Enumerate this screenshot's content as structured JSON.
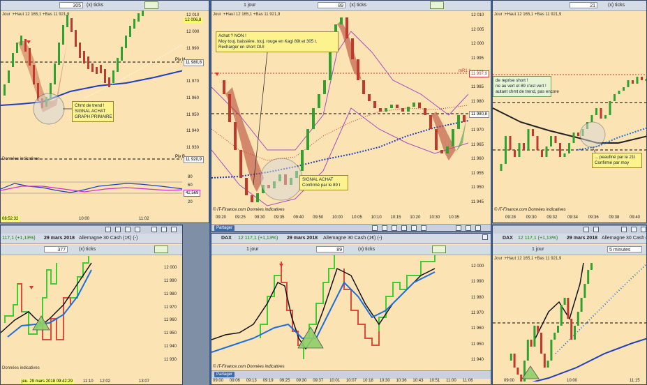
{
  "toolbar": {
    "ticks_label": "(x) ticks",
    "period_label": "1 jour",
    "period_5min": "5 minutes",
    "p1_ticks": "305",
    "p2_ticks": "89",
    "p3_ticks": "21",
    "p4_ticks": "377",
    "p5_ticks": "89",
    "symbol": "DAX",
    "quote": "12 117,1 (+1,13%)",
    "quote_short": "117,1 (+1,13%)",
    "date": "29 mars 2018",
    "instrument": "Allemagne 30 Cash (1€) (-)"
  },
  "common": {
    "day_info": "Jour :+Haut 12 165,1 +Bas 11 921,9",
    "donnees": "Données indicatives",
    "itf": "© IT-Finance.com  Données indicatives",
    "partager": "Partager",
    "piv_h": "Piv H",
    "piv_b": "Piv B"
  },
  "panel1": {
    "price_tag": "12 006,8",
    "pivh_tag": "11 980,8",
    "pivb_tag": "11 920,9",
    "ind_tag": "42,569",
    "time_tag": "08:52:32",
    "yticks": [
      "12 010",
      "12 000",
      "11 990",
      "11 980",
      "11 970",
      "11 960",
      "11 950",
      "11 940",
      "11 930"
    ],
    "ind_ticks": [
      "80",
      "60",
      "40",
      "20"
    ],
    "xticks": [
      "10:00",
      "11:02"
    ],
    "note": "Chmt de trend !\nSIGNAL ACHAT\nGRAPH PRIMAIRE"
  },
  "panel2": {
    "yticks": [
      "12 010",
      "12 005",
      "12 000",
      "11 995",
      "11 990",
      "11 985",
      "11 980",
      "11 975",
      "11 970",
      "11 965",
      "11 960",
      "11 955",
      "11 950",
      "11 945"
    ],
    "xticks": [
      "09:20",
      "09:25",
      "09:30",
      "09:35",
      "09:40",
      "09:50",
      "10:00",
      "10:05",
      "10:10",
      "10:15",
      "10:20",
      "10:30",
      "10:35"
    ],
    "r1_label": "mR1 1",
    "r1_tag": "11 997,9",
    "mid_tag": "11 980,8",
    "note": "Achat ? NON !\nMoy touj. baissière, touj. rouge en Kagi 89t et 305 t.\nRecharger en short OUI",
    "signal": "SIGNAL ACHAT\nConfirmé par le 89 t"
  },
  "panel3": {
    "xticks": [
      "09:28",
      "09:30",
      "09:32",
      "09:34",
      "09:36",
      "09:38",
      "09:40"
    ],
    "note_green": "de reprise short !\nne au vert et 89 c'est vert !\nautant chmt de trend, pas encore",
    "note": "... peaufiné par le 21t\nConfirmé par moy"
  },
  "panel4": {
    "yticks": [
      "12 000",
      "11 990",
      "11 980",
      "11 970",
      "11 960",
      "11 950",
      "11 940",
      "11 930"
    ],
    "xticks": [
      "11:10",
      "12:02",
      "13:07"
    ],
    "date_time": "jeu. 29 mars 2018 09:42:29"
  },
  "panel5": {
    "yticks": [
      "12 000",
      "11 990",
      "11 980",
      "11 970",
      "11 960",
      "11 950",
      "11 940"
    ],
    "xticks": [
      "09:00",
      "09:06",
      "09:13",
      "09:19",
      "09:25",
      "09:30",
      "09:37",
      "10:01",
      "10:07",
      "10:18",
      "10:30",
      "10:36",
      "10:43",
      "10:51",
      "11:00",
      "11:06"
    ]
  },
  "panel6": {
    "xticks": [
      "09:00",
      "10:00",
      "11:15"
    ]
  },
  "colors": {
    "bg": "#fbe3b4",
    "up": "#2fa12f",
    "down": "#c0392b",
    "kagi_up": "#3ccf2f",
    "kagi_down": "#e04a3a",
    "blue": "#1f3fc0",
    "dot_blue": "#1b6ee0"
  }
}
